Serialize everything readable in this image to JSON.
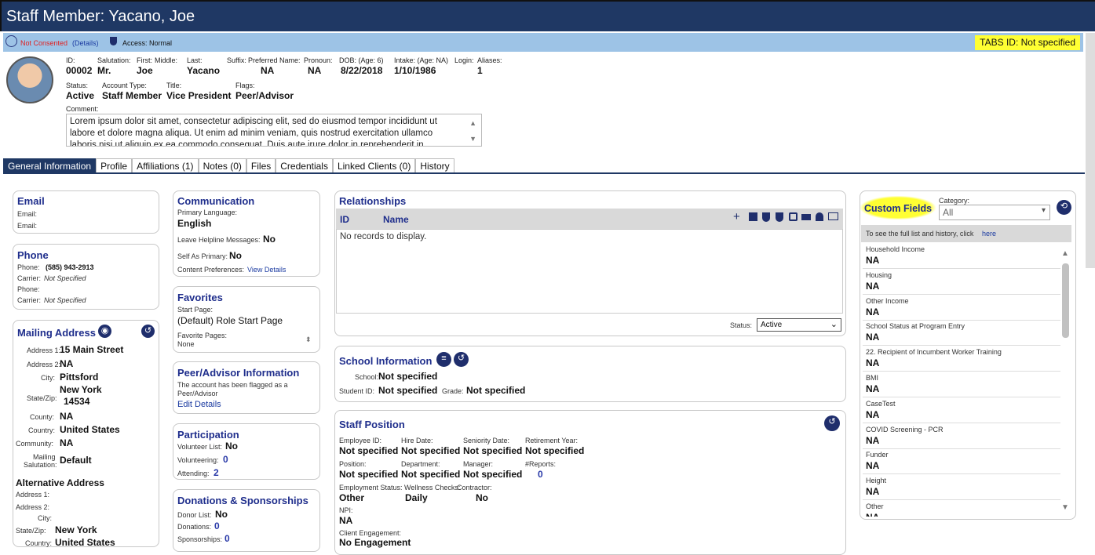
{
  "window": {
    "title": "Staff Member: Yacano, Joe"
  },
  "consent": {
    "status": "Not Consented",
    "details": "(Details)",
    "access": "Access: Normal",
    "tabs_id": "TABS ID: Not specified"
  },
  "header": {
    "labels": {
      "id": "ID:",
      "salutation": "Salutation:",
      "first": "First:",
      "middle": "Middle:",
      "last": "Last:",
      "suffix": "Suffix:",
      "preferred": "Preferred Name:",
      "pronoun": "Pronoun:",
      "dob": "DOB: (Age: 6)",
      "intake": "Intake: (Age: NA)",
      "login": "Login:",
      "aliases": "Aliases:",
      "status": "Status:",
      "account_type": "Account Type:",
      "title": "Title:",
      "flags": "Flags:",
      "comment": "Comment:"
    },
    "values": {
      "id": "00002",
      "salutation": "Mr.",
      "first": "Joe",
      "last": "Yacano",
      "preferred": "NA",
      "pronoun": "NA",
      "dob": "8/22/2018",
      "intake": "1/10/1986",
      "aliases": "1",
      "status": "Active",
      "account_type": "Staff Member",
      "title": "Vice President",
      "flags": "Peer/Advisor"
    },
    "comment_text": "Lorem ipsum dolor sit amet, consectetur adipiscing elit, sed do eiusmod tempor incididunt ut labore et dolore magna aliqua. Ut enim ad minim veniam, quis nostrud exercitation ullamco laboris nisi ut aliquip ex ea commodo consequat. Duis aute irure dolor in reprehenderit in"
  },
  "tabs": [
    "General Information",
    "Profile",
    "Affiliations (1)",
    "Notes (0)",
    "Files",
    "Credentials",
    "Linked Clients (0)",
    "History"
  ],
  "email": {
    "title": "Email",
    "l1": "Email:",
    "l2": "Email:"
  },
  "phone": {
    "title": "Phone",
    "phone_label": "Phone:",
    "phone": "(585) 943-2913",
    "carrier_label": "Carrier:",
    "carrier": "Not Specified",
    "phone2_label": "Phone:",
    "carrier2_label": "Carrier:",
    "carrier2": "Not Specified"
  },
  "mailing": {
    "title": "Mailing Address",
    "l_addr1": "Address 1:",
    "addr1": "15 Main Street",
    "l_addr2": "Address 2:",
    "addr2": "NA",
    "l_city": "City:",
    "city": "Pittsford",
    "l_statezip": "State/Zip:",
    "state": "New York",
    "zip": "14534",
    "l_county": "County:",
    "county": "NA",
    "l_country": "Country:",
    "country": "United States",
    "l_community": "Community:",
    "community": "NA",
    "l_salut1": "Mailing",
    "l_salut2": "Salutation:",
    "salutation": "Default",
    "alt_title": "Alternative Address",
    "alt_addr1": "Address 1:",
    "alt_addr2": "Address 2:",
    "alt_city": "City:",
    "alt_statezip": "State/Zip:",
    "alt_state": "New York",
    "alt_country_label": "Country:",
    "alt_country": "United States"
  },
  "communication": {
    "title": "Communication",
    "lang_label": "Primary Language:",
    "lang": "English",
    "helpline_label": "Leave Helpline Messages:",
    "helpline": "No",
    "self_label": "Self As Primary:",
    "self": "No",
    "content_label": "Content Preferences:",
    "content_link": "View Details"
  },
  "favorites": {
    "title": "Favorites",
    "start_label": "Start Page:",
    "start": "(Default) Role Start Page",
    "fav_label": "Favorite Pages:",
    "fav": "None"
  },
  "peer": {
    "title": "Peer/Advisor Information",
    "text1": "The account has been flagged as a",
    "text2": "Peer/Advisor",
    "link": "Edit Details"
  },
  "participation": {
    "title": "Participation",
    "vol_list_label": "Volunteer List:",
    "vol_list": "No",
    "volunteering_label": "Volunteering:",
    "volunteering": "0",
    "attending_label": "Attending:",
    "attending": "2"
  },
  "donations": {
    "title": "Donations & Sponsorships",
    "donor_label": "Donor List:",
    "donor": "No",
    "donations_label": "Donations:",
    "donations": "0",
    "sponsorships_label": "Sponsorships:",
    "sponsorships": "0"
  },
  "relationships": {
    "title": "Relationships",
    "col_id": "ID",
    "col_name": "Name",
    "empty": "No records to display.",
    "status_label": "Status:",
    "status": "Active"
  },
  "school": {
    "title": "School Information",
    "school_label": "School:",
    "school": "Not specified",
    "student_label": "Student ID:",
    "student": "Not specified",
    "grade_label": "Grade:",
    "grade": "Not specified"
  },
  "staff": {
    "title": "Staff Position",
    "employee_label": "Employee ID:",
    "employee": "Not specified",
    "hire_label": "Hire Date:",
    "hire": "Not specified",
    "seniority_label": "Seniority Date:",
    "seniority": "Not specified",
    "retire_label": "Retirement Year:",
    "retire": "Not specified",
    "position_label": "Position:",
    "position": "Not specified",
    "dept_label": "Department:",
    "dept": "Not specified",
    "manager_label": "Manager:",
    "manager": "Not specified",
    "reports_label": "#Reports:",
    "reports": "0",
    "emp_status_label": "Employment Status:",
    "emp_status": "Other",
    "wellness_label": "Wellness Checks:",
    "wellness": "Daily",
    "contractor_label": "Contractor:",
    "contractor": "No",
    "npi_label": "NPI:",
    "npi": "NA",
    "engagement_label": "Client Engagement:",
    "engagement": "No Engagement"
  },
  "custom": {
    "title": "Custom Fields",
    "category_label": "Category:",
    "category": "All",
    "history_text": "To see the full list and history, click",
    "history_link": "here",
    "items": [
      {
        "label": "Household Income",
        "value": "NA"
      },
      {
        "label": "Housing",
        "value": "NA"
      },
      {
        "label": "Other Income",
        "value": "NA"
      },
      {
        "label": "School Status at Program Entry",
        "value": "NA"
      },
      {
        "label": "22. Recipient of Incumbent Worker Training",
        "value": "NA"
      },
      {
        "label": "BMI",
        "value": "NA"
      },
      {
        "label": "CaseTest",
        "value": "NA"
      },
      {
        "label": "COVID Screening - PCR",
        "value": "NA"
      },
      {
        "label": "Funder",
        "value": "NA"
      },
      {
        "label": "Height",
        "value": "NA"
      },
      {
        "label": "Other",
        "value": "NA"
      }
    ]
  },
  "colors": {
    "navy": "#1f3864",
    "highlight": "#ffff33",
    "link": "#1a3aa0",
    "light_blue": "#9dc3e6"
  }
}
